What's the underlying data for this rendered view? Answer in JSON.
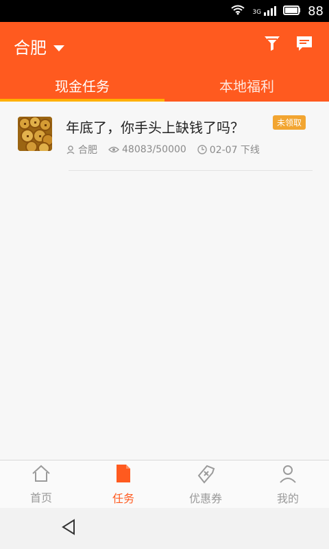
{
  "status": {
    "network": "3G",
    "battery_text": "88"
  },
  "header": {
    "city": "合肥",
    "tabs": [
      {
        "label": "现金任务"
      },
      {
        "label": "本地福利"
      }
    ]
  },
  "items": [
    {
      "title": "年底了，你手头上缺钱了吗？",
      "badge": "未领取",
      "location": "合肥",
      "views": "48083/50000",
      "time": "02-07 下线"
    }
  ],
  "bottom_nav": [
    {
      "label": "首页"
    },
    {
      "label": "任务"
    },
    {
      "label": "优惠券"
    },
    {
      "label": "我的"
    }
  ],
  "colors": {
    "accent": "#ff5a1f",
    "tab_indicator": "#ffb000",
    "badge": "#f2a531"
  }
}
